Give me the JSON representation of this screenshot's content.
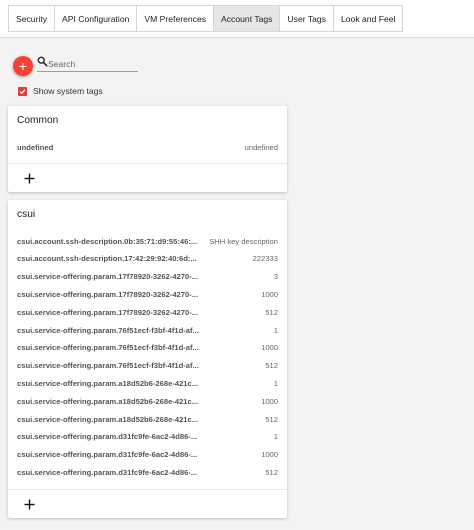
{
  "tabs": [
    {
      "label": "Security",
      "active": false
    },
    {
      "label": "API Configuration",
      "active": false
    },
    {
      "label": "VM Preferences",
      "active": false
    },
    {
      "label": "Account Tags",
      "active": true
    },
    {
      "label": "User Tags",
      "active": false
    },
    {
      "label": "Look and Feel",
      "active": false
    }
  ],
  "toolbar": {
    "add_icon": "plus-icon",
    "search_icon": "search-icon",
    "search_placeholder": "Search",
    "search_value": ""
  },
  "filter": {
    "show_system_tags_label": "Show system tags",
    "show_system_tags_checked": true
  },
  "colors": {
    "accent": "#f44336",
    "checkbox": "#e53935",
    "active_tab": "#e6e6e6"
  },
  "groups": [
    {
      "title": "Common",
      "rows": [
        {
          "key": "undefined",
          "value": "undefined"
        }
      ]
    },
    {
      "title": "csui",
      "rows": [
        {
          "key": "csui.account.ssh-description.0b:35:71:d9:55:46:...",
          "value": "SHH key description"
        },
        {
          "key": "csui.account.ssh-description.17:42:29:92:40:6d:...",
          "value": "222333"
        },
        {
          "key": "csui.service-offering.param.17f78920-3262-4270-...",
          "value": "3"
        },
        {
          "key": "csui.service-offering.param.17f78920-3262-4270-...",
          "value": "1000"
        },
        {
          "key": "csui.service-offering.param.17f78920-3262-4270-...",
          "value": "512"
        },
        {
          "key": "csui.service-offering.param.76f51ecf-f3bf-4f1d-af...",
          "value": "1"
        },
        {
          "key": "csui.service-offering.param.76f51ecf-f3bf-4f1d-af...",
          "value": "1000"
        },
        {
          "key": "csui.service-offering.param.76f51ecf-f3bf-4f1d-af...",
          "value": "512"
        },
        {
          "key": "csui.service-offering.param.a18d52b6-268e-421c...",
          "value": "1"
        },
        {
          "key": "csui.service-offering.param.a18d52b6-268e-421c...",
          "value": "1000"
        },
        {
          "key": "csui.service-offering.param.a18d52b6-268e-421c...",
          "value": "512"
        },
        {
          "key": "csui.service-offering.param.d31fc9fe-6ac2-4d86-...",
          "value": "1"
        },
        {
          "key": "csui.service-offering.param.d31fc9fe-6ac2-4d86-...",
          "value": "1000"
        },
        {
          "key": "csui.service-offering.param.d31fc9fe-6ac2-4d86-...",
          "value": "512"
        }
      ]
    }
  ]
}
